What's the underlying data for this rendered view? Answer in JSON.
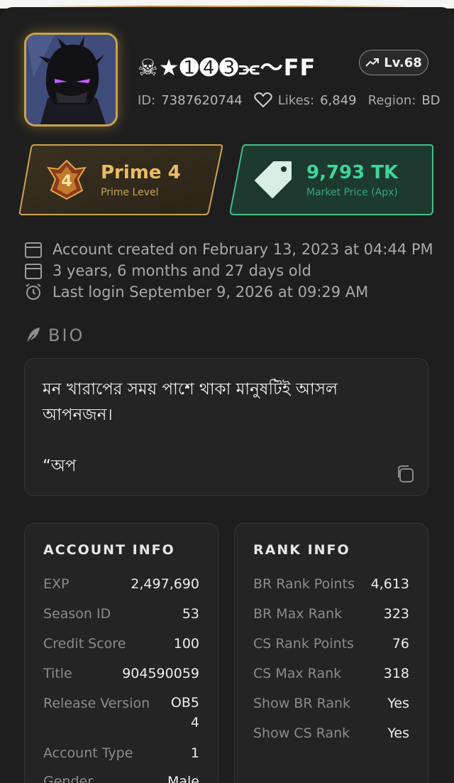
{
  "profile": {
    "username": "☠★➊➍➌⫘〜FF",
    "level": "Lv.68",
    "id_label": "ID:",
    "id_value": "7387620744",
    "likes_label": "Likes:",
    "likes_value": "6,849",
    "region_label": "Region:",
    "region_value": "BD"
  },
  "prime": {
    "level_number": "4",
    "title": "Prime 4",
    "subtitle": "Prime Level"
  },
  "market": {
    "value": "9,793 TK",
    "subtitle": "Market Price (Apx)"
  },
  "account_lines": [
    {
      "icon": "calendar-icon",
      "text": "Account created on February 13, 2023 at 04:44 PM"
    },
    {
      "icon": "calendar-icon",
      "text": "3 years, 6 months and 27 days old"
    },
    {
      "icon": "alarm-clock-icon",
      "text": "Last login September 9, 2026 at 09:29 AM"
    }
  ],
  "bio": {
    "heading": "BIO",
    "text": "মন খারাপের সময় পাশে থাকা মানুষটিই আসল আপনজন।\n\n“অপ"
  },
  "account_info": {
    "title": "ACCOUNT INFO",
    "rows": [
      {
        "label": "EXP",
        "value": "2,497,690"
      },
      {
        "label": "Season ID",
        "value": "53"
      },
      {
        "label": "Credit Score",
        "value": "100"
      },
      {
        "label": "Title",
        "value": "904590059"
      },
      {
        "label": "Release Version",
        "value": "OB5\n4"
      },
      {
        "label": "Account Type",
        "value": "1"
      },
      {
        "label": "Gender",
        "value": "Male"
      }
    ]
  },
  "rank_info": {
    "title": "RANK INFO",
    "rows": [
      {
        "label": "BR Rank Points",
        "value": "4,613"
      },
      {
        "label": "BR Max Rank",
        "value": "323"
      },
      {
        "label": "CS Rank Points",
        "value": "76"
      },
      {
        "label": "CS Max Rank",
        "value": "318"
      },
      {
        "label": "Show BR Rank",
        "value": "Yes"
      },
      {
        "label": "Show CS Rank",
        "value": "Yes"
      }
    ]
  },
  "colors": {
    "gold": "#e9bd62",
    "green": "#3fd49a",
    "background": "#1e1e1e"
  }
}
